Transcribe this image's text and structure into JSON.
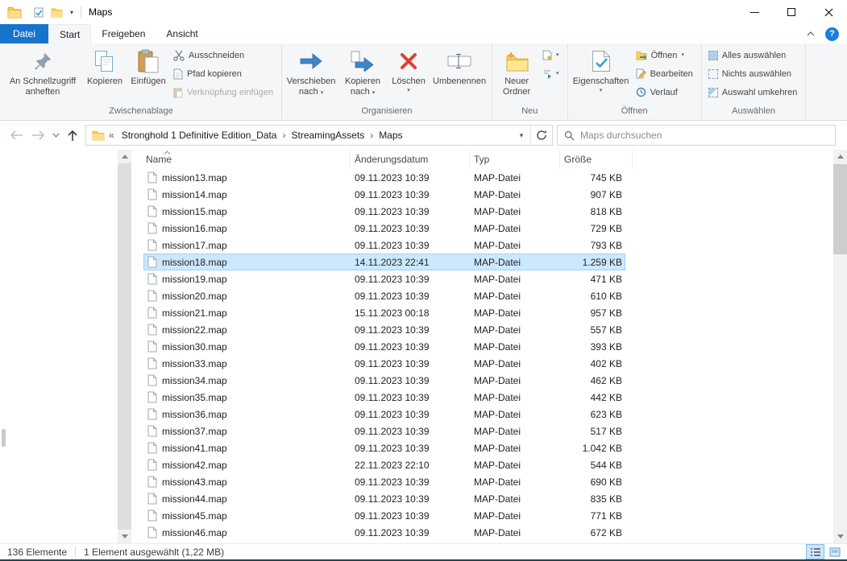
{
  "icons": {
    "dropdown": "▾",
    "crumb_separator": "›",
    "overflow": "«"
  },
  "window": {
    "title": "Maps"
  },
  "tabs": {
    "file": "Datei",
    "items": [
      "Start",
      "Freigeben",
      "Ansicht"
    ],
    "active": "Start"
  },
  "ribbon": {
    "clipboard": {
      "label": "Zwischenablage",
      "pin": "An Schnellzugriff anheften",
      "copy": "Kopieren",
      "paste": "Einfügen",
      "cut": "Ausschneiden",
      "copy_path": "Pfad kopieren",
      "paste_shortcut": "Verknüpfung einfügen"
    },
    "organize": {
      "label": "Organisieren",
      "move_to": "Verschieben nach",
      "copy_to": "Kopieren nach",
      "delete": "Löschen",
      "rename": "Umbenennen"
    },
    "new": {
      "label": "Neu",
      "new_folder": "Neuer Ordner"
    },
    "open": {
      "label": "Öffnen",
      "properties": "Eigenschaften",
      "open": "Öffnen",
      "edit": "Bearbeiten",
      "history": "Verlauf"
    },
    "select": {
      "label": "Auswählen",
      "select_all": "Alles auswählen",
      "select_none": "Nichts auswählen",
      "invert": "Auswahl umkehren"
    }
  },
  "address": {
    "crumbs": [
      "Stronghold 1 Definitive Edition_Data",
      "StreamingAssets",
      "Maps"
    ],
    "search_placeholder": "Maps durchsuchen"
  },
  "filelist": {
    "columns": {
      "name": "Name",
      "date": "Änderungsdatum",
      "type": "Typ",
      "size": "Größe"
    },
    "rows": [
      {
        "name": "mission13.map",
        "date": "09.11.2023 10:39",
        "type": "MAP-Datei",
        "size": "745 KB"
      },
      {
        "name": "mission14.map",
        "date": "09.11.2023 10:39",
        "type": "MAP-Datei",
        "size": "907 KB"
      },
      {
        "name": "mission15.map",
        "date": "09.11.2023 10:39",
        "type": "MAP-Datei",
        "size": "818 KB"
      },
      {
        "name": "mission16.map",
        "date": "09.11.2023 10:39",
        "type": "MAP-Datei",
        "size": "729 KB"
      },
      {
        "name": "mission17.map",
        "date": "09.11.2023 10:39",
        "type": "MAP-Datei",
        "size": "793 KB"
      },
      {
        "name": "mission18.map",
        "date": "14.11.2023 22:41",
        "type": "MAP-Datei",
        "size": "1.259 KB",
        "selected": true
      },
      {
        "name": "mission19.map",
        "date": "09.11.2023 10:39",
        "type": "MAP-Datei",
        "size": "471 KB"
      },
      {
        "name": "mission20.map",
        "date": "09.11.2023 10:39",
        "type": "MAP-Datei",
        "size": "610 KB"
      },
      {
        "name": "mission21.map",
        "date": "15.11.2023 00:18",
        "type": "MAP-Datei",
        "size": "957 KB"
      },
      {
        "name": "mission22.map",
        "date": "09.11.2023 10:39",
        "type": "MAP-Datei",
        "size": "557 KB"
      },
      {
        "name": "mission30.map",
        "date": "09.11.2023 10:39",
        "type": "MAP-Datei",
        "size": "393 KB"
      },
      {
        "name": "mission33.map",
        "date": "09.11.2023 10:39",
        "type": "MAP-Datei",
        "size": "402 KB"
      },
      {
        "name": "mission34.map",
        "date": "09.11.2023 10:39",
        "type": "MAP-Datei",
        "size": "462 KB"
      },
      {
        "name": "mission35.map",
        "date": "09.11.2023 10:39",
        "type": "MAP-Datei",
        "size": "442 KB"
      },
      {
        "name": "mission36.map",
        "date": "09.11.2023 10:39",
        "type": "MAP-Datei",
        "size": "623 KB"
      },
      {
        "name": "mission37.map",
        "date": "09.11.2023 10:39",
        "type": "MAP-Datei",
        "size": "517 KB"
      },
      {
        "name": "mission41.map",
        "date": "09.11.2023 10:39",
        "type": "MAP-Datei",
        "size": "1.042 KB"
      },
      {
        "name": "mission42.map",
        "date": "22.11.2023 22:10",
        "type": "MAP-Datei",
        "size": "544 KB"
      },
      {
        "name": "mission43.map",
        "date": "09.11.2023 10:39",
        "type": "MAP-Datei",
        "size": "690 KB"
      },
      {
        "name": "mission44.map",
        "date": "09.11.2023 10:39",
        "type": "MAP-Datei",
        "size": "835 KB"
      },
      {
        "name": "mission45.map",
        "date": "09.11.2023 10:39",
        "type": "MAP-Datei",
        "size": "771 KB"
      },
      {
        "name": "mission46.map",
        "date": "09.11.2023 10:39",
        "type": "MAP-Datei",
        "size": "672 KB"
      }
    ]
  },
  "statusbar": {
    "count": "136 Elemente",
    "selection": "1 Element ausgewählt (1,22 MB)"
  }
}
